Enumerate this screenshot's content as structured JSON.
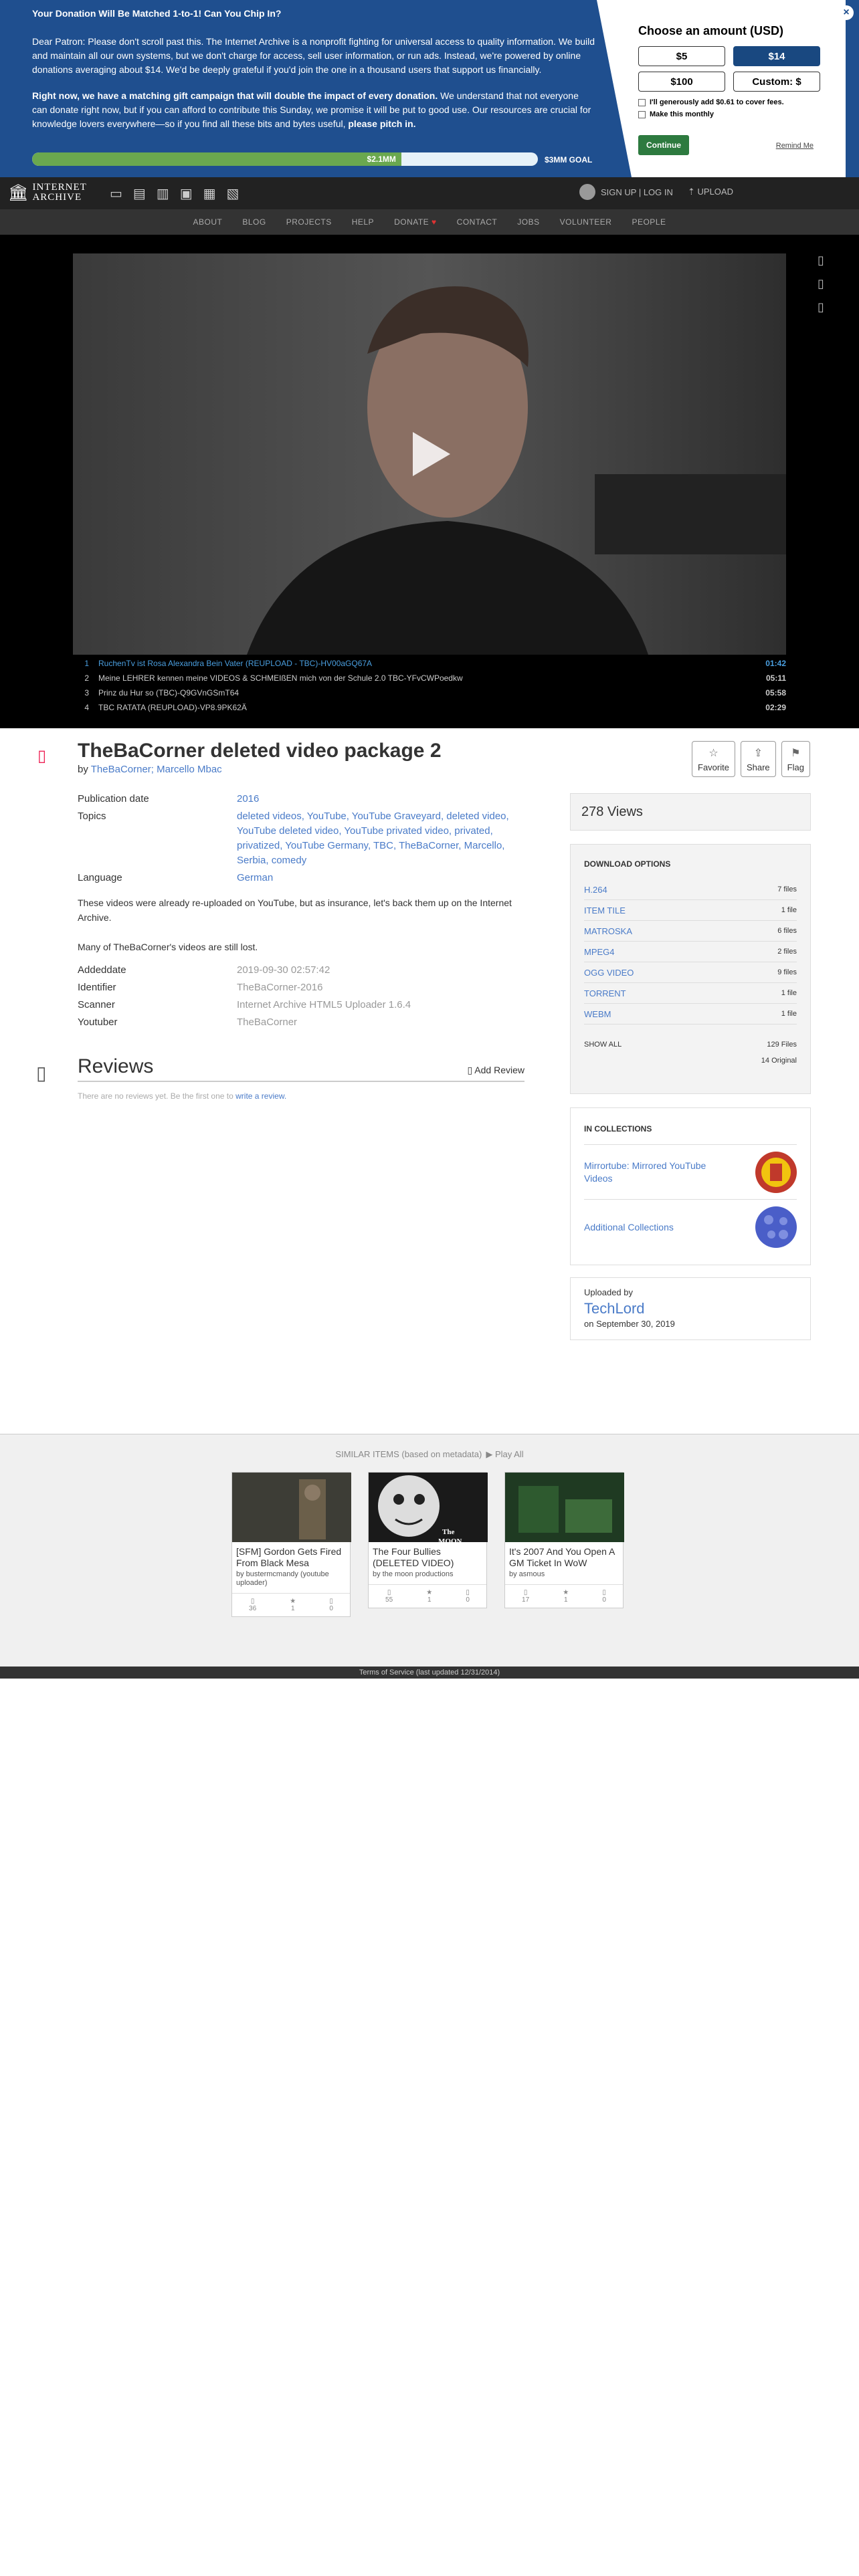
{
  "banner": {
    "heading": "Your Donation Will Be Matched 1-to-1! Can You Chip In?",
    "para1": "Dear Patron: Please don't scroll past this. The Internet Archive is a nonprofit fighting for universal access to quality information. We build and maintain all our own systems, but we don't charge for access, sell user information, or run ads. Instead, we're powered by online donations averaging about $14. We'd be deeply grateful if you'd join the one in a thousand users that support us financially.",
    "para2_bold": "Right now, we have a matching gift campaign that will double the impact of every donation.",
    "para2_rest": " We understand that not everyone can donate right now, but if you can afford to contribute this Sunday, we promise it will be put to good use. Our resources are crucial for knowledge lovers everywhere—so if you find all these bits and bytes useful,",
    "para2_end": " please pitch in.",
    "raised": "$2.1MM",
    "progress_fraction": 0.73,
    "goal": "$3MM GOAL",
    "choose_label": "Choose an amount (USD)",
    "amounts": [
      "$5",
      "$14",
      "$100",
      "Custom: $"
    ],
    "selected_amount": "$14",
    "fees_label": "I'll generously add $0.61 to cover fees.",
    "monthly_label": "Make this monthly",
    "continue_label": "Continue",
    "remind_label": "Remind Me",
    "close_icon": "×"
  },
  "nav": {
    "logo_line1": "INTERNET",
    "logo_line2": "ARCHIVE",
    "signup": "SIGN UP | LOG IN",
    "upload": "UPLOAD",
    "links": [
      "ABOUT",
      "BLOG",
      "PROJECTS",
      "HELP",
      "DONATE",
      "CONTACT",
      "JOBS",
      "VOLUNTEER",
      "PEOPLE"
    ]
  },
  "playlist": [
    {
      "n": "1",
      "title": "RuchenTv ist Rosa Alexandra Bein Vater (REUPLOAD - TBC)-HV00aGQ67A",
      "dur": "01:42"
    },
    {
      "n": "2",
      "title": "Meine LEHRER kennen meine VIDEOS & SCHMEIßEN mich von der Schule 2.0 TBC-YFvCWPoedkw",
      "dur": "05:11"
    },
    {
      "n": "3",
      "title": "Prinz du Hur so (TBC)-Q9GVnGSmT64",
      "dur": "05:58"
    },
    {
      "n": "4",
      "title": "TBC RATATA (REUPLOAD)-VP8.9PK62Ä",
      "dur": "02:29"
    }
  ],
  "item": {
    "title": "TheBaCorner deleted video package 2",
    "by_label": "by",
    "creator": "TheBaCorner; Marcello Mbac",
    "favorite": "Favorite",
    "share": "Share",
    "flag": "Flag",
    "pub_date_label": "Publication date",
    "pub_date": "2016",
    "topics_label": "Topics",
    "topics": "deleted videos, YouTube, YouTube Graveyard, deleted video, YouTube deleted video, YouTube privated video, privated, privatized, YouTube Germany, TBC, TheBaCorner, Marcello, Serbia, comedy",
    "language_label": "Language",
    "language": "German",
    "desc1": "These videos were already re-uploaded on YouTube, but as insurance, let's back them up on the Internet Archive.",
    "desc2": "Many of TheBaCorner's videos are still lost.",
    "addeddate_label": "Addeddate",
    "addeddate": "2019-09-30 02:57:42",
    "identifier_label": "Identifier",
    "identifier": "TheBaCorner-2016",
    "scanner_label": "Scanner",
    "scanner": "Internet Archive HTML5 Uploader 1.6.4",
    "youtuber_label": "Youtuber",
    "youtuber": "TheBaCorner"
  },
  "reviews": {
    "title": "Reviews",
    "add": "Add Review",
    "none_text": "There are no reviews yet. Be the first one to ",
    "none_link": "write a review."
  },
  "sidebar": {
    "views": "278 Views",
    "download_title": "DOWNLOAD OPTIONS",
    "downloads": [
      {
        "fmt": "H.264",
        "cnt": "7 files"
      },
      {
        "fmt": "ITEM TILE",
        "cnt": "1 file"
      },
      {
        "fmt": "MATROSKA",
        "cnt": "6 files"
      },
      {
        "fmt": "MPEG4",
        "cnt": "2 files"
      },
      {
        "fmt": "OGG VIDEO",
        "cnt": "9 files"
      },
      {
        "fmt": "TORRENT",
        "cnt": "1 file"
      },
      {
        "fmt": "WEBM",
        "cnt": "1 file"
      }
    ],
    "show_all": "SHOW ALL",
    "total_files": "129 Files",
    "original": "14 Original",
    "collections_title": "IN COLLECTIONS",
    "collections": [
      "Mirrortube: Mirrored YouTube Videos",
      "Additional Collections"
    ],
    "uploaded_by_label": "Uploaded by",
    "uploader": "TechLord",
    "uploaded_on": "on September 30, 2019"
  },
  "similar": {
    "heading": "SIMILAR ITEMS (based on metadata)",
    "play_all": "Play All",
    "items": [
      {
        "title": "[SFM] Gordon Gets Fired From Black Mesa",
        "by": "by bustermcmandy (youtube uploader)",
        "s1": "36",
        "s2": "1",
        "s3": "0"
      },
      {
        "title": "The Four Bullies (DELETED VIDEO)",
        "by": "by the moon productions",
        "s1": "55",
        "s2": "1",
        "s3": "0"
      },
      {
        "title": "It's 2007 And You Open A GM Ticket In WoW",
        "by": "by asmous",
        "s1": "17",
        "s2": "1",
        "s3": "0"
      }
    ]
  },
  "terms": "Terms of Service (last updated 12/31/2014)"
}
